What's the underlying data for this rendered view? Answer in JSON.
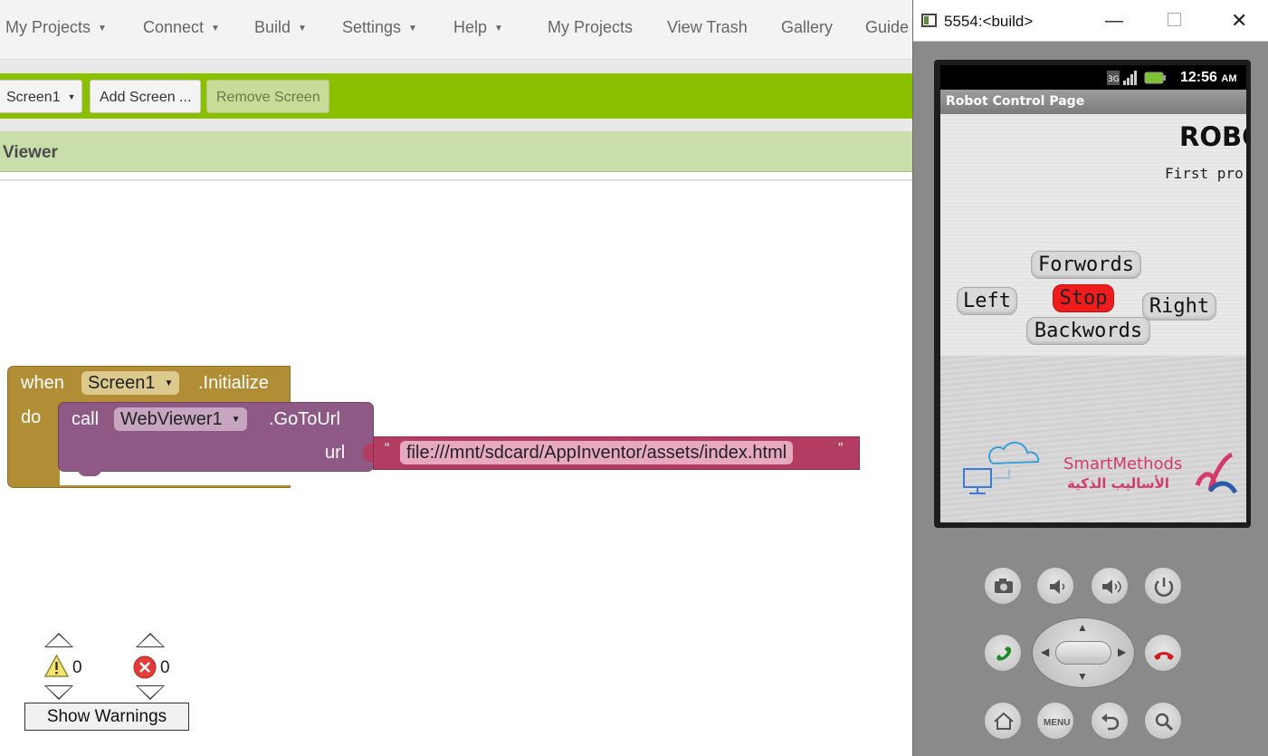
{
  "menu": {
    "items": [
      {
        "label": "My Projects",
        "dropdown": true
      },
      {
        "label": "Connect",
        "dropdown": true
      },
      {
        "label": "Build",
        "dropdown": true
      },
      {
        "label": "Settings",
        "dropdown": true
      },
      {
        "label": "Help",
        "dropdown": true
      }
    ],
    "links": [
      "My Projects",
      "View Trash",
      "Gallery",
      "Guide"
    ]
  },
  "toolbar": {
    "screen_select": "Screen1",
    "add_screen": "Add Screen ...",
    "remove_screen": "Remove Screen"
  },
  "viewer": {
    "title": "Viewer"
  },
  "blocks": {
    "event": {
      "when": "when",
      "component": "Screen1",
      "event": ".Initialize",
      "do": "do"
    },
    "call": {
      "call": "call",
      "component": "WebViewer1",
      "method": ".GoToUrl",
      "param": "url"
    },
    "string": {
      "open_quote": "“",
      "value": "file:///mnt/sdcard/AppInventor/assets/index.html",
      "close_quote": "”"
    }
  },
  "warnings": {
    "warning_count": "0",
    "error_count": "0",
    "show_button": "Show Warnings"
  },
  "emulator": {
    "window_title": "5554:<build>",
    "status_time": "12:56",
    "status_ampm": "AM",
    "app_title": "Robot Control Page",
    "page_title": "ROBO",
    "page_subtitle": "First pro",
    "controls": {
      "forward": "Forwords",
      "left": "Left",
      "stop": "Stop",
      "right": "Right",
      "backward": "Backwords"
    },
    "logo_text": "SmartMethods",
    "logo_text_ar": "الأساليب الذكية"
  },
  "colors": {
    "toolbar_green": "#8bc000",
    "viewer_header": "#c9deab",
    "event_block": "#b18e35",
    "call_block": "#8e5a85",
    "string_block": "#b33c63",
    "stop_button": "#ee1c1c"
  }
}
